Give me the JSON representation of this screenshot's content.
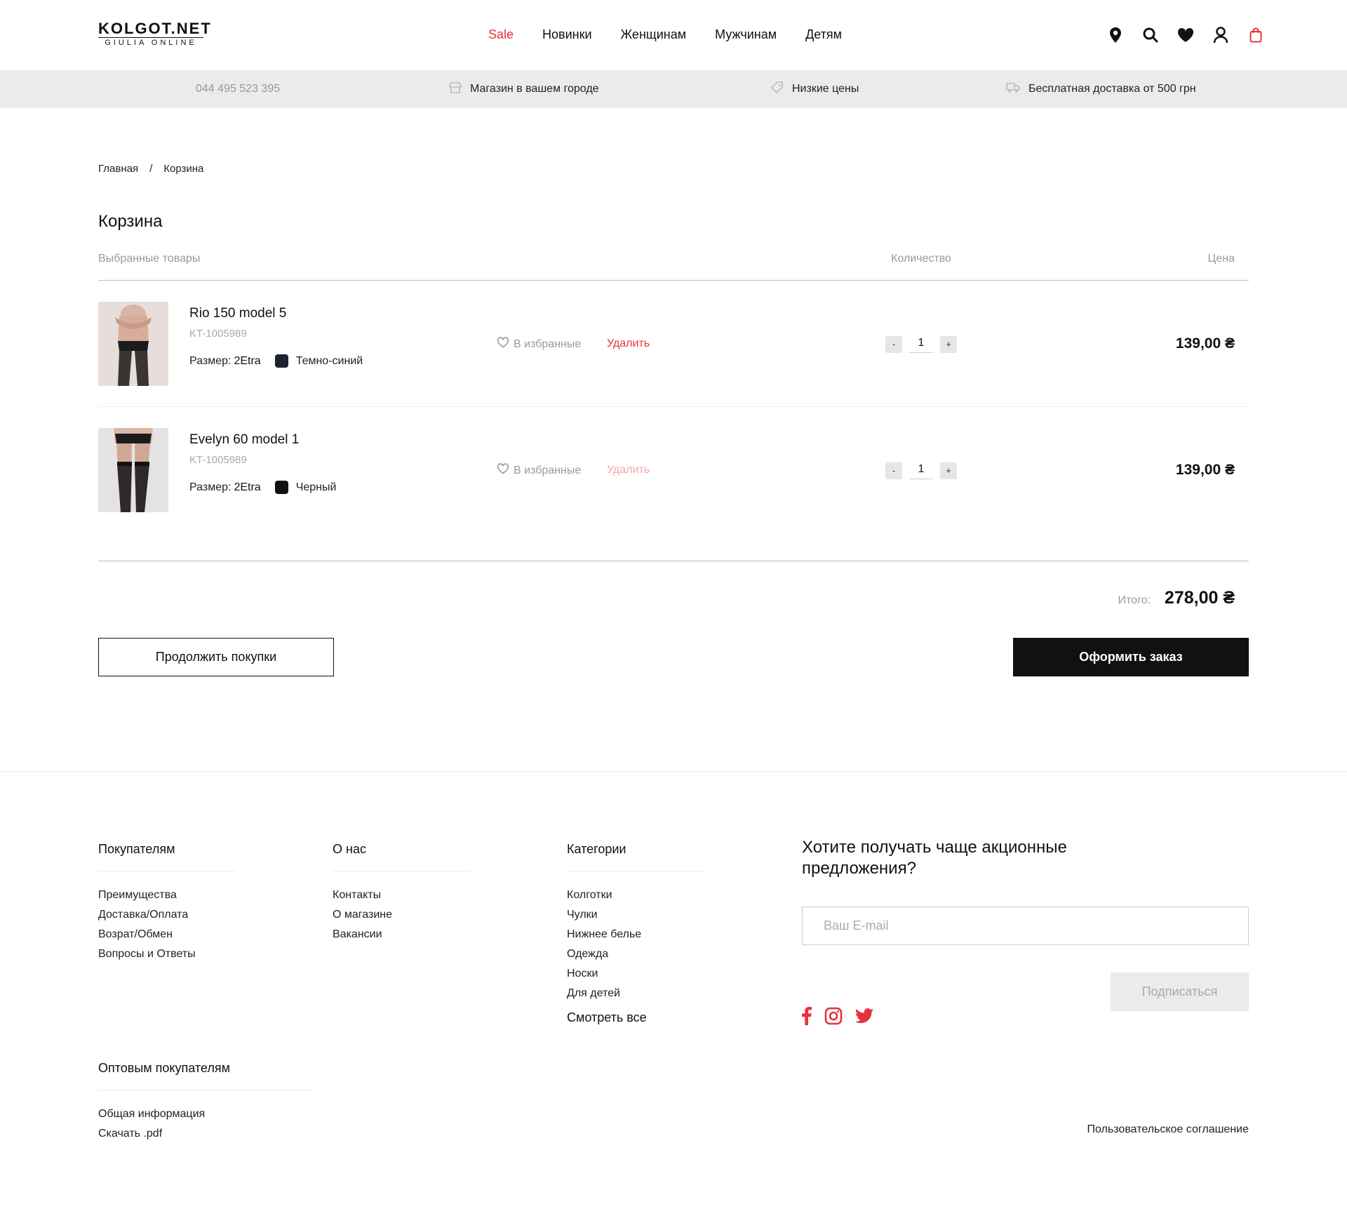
{
  "header": {
    "logo_main": "KOLGOT.NET",
    "logo_sub": "GIULIA ONLINE",
    "nav": [
      "Sale",
      "Новинки",
      "Женщинам",
      "Мужчинам",
      "Детям"
    ],
    "accent_color": "#e8313e"
  },
  "infobar": {
    "phone": "044 495 523 395",
    "store": "Магазин в вашем городе",
    "prices": "Низкие цены",
    "delivery": "Бесплатная доставка от 500 грн"
  },
  "breadcrumb": {
    "home": "Главная",
    "separator": "/",
    "current": "Корзина"
  },
  "cart": {
    "title": "Корзина",
    "col_products": "Выбранные товары",
    "col_qty": "Количество",
    "col_price": "Цена",
    "fav_label": "В избранные",
    "delete_label": "Удалить",
    "size_label": "Размер:",
    "items": [
      {
        "name": "Rio 150 model 5",
        "sku": "KT-1005989",
        "size": "2Etra",
        "color_name": "Темно-синий",
        "color": "#1e2333",
        "qty": "1",
        "price": "139,00 ₴",
        "delete_color": "#e8313e"
      },
      {
        "name": "Evelyn 60 model 1",
        "sku": "KT-1005989",
        "size": "2Etra",
        "color_name": "Черный",
        "color": "#111111",
        "qty": "1",
        "price": "139,00 ₴",
        "delete_color": "#f2a5ab"
      }
    ],
    "qty_minus": "-",
    "qty_plus": "+",
    "total_label": "Итого:",
    "total_value": "278,00 ₴",
    "continue_label": "Продолжить покупки",
    "order_label": "Оформить заказ"
  },
  "footer": {
    "buyers": {
      "title": "Покупателям",
      "links": [
        "Преимущества",
        "Доставка/Оплата",
        "Возрат/Обмен",
        "Вопросы и Ответы"
      ]
    },
    "about": {
      "title": "О нас",
      "links": [
        "Контакты",
        "О магазине",
        "Вакансии"
      ]
    },
    "categories": {
      "title": "Категории",
      "links": [
        "Колготки",
        "Чулки",
        "Нижнее белье",
        "Одежда",
        "Носки",
        "Для детей"
      ],
      "see_all": "Смотреть все"
    },
    "wholesale": {
      "title": "Оптовым покупателям",
      "links": [
        "Общая информация",
        "Скачать .pdf"
      ]
    },
    "subscribe": {
      "title": "Хотите получать чаще акционные предложения?",
      "email_placeholder": "Ваш E-mail",
      "button": "Подписаться"
    },
    "socials": [
      "facebook-icon",
      "instagram-icon",
      "twitter-icon"
    ],
    "agreement": "Пользовательское соглашение"
  }
}
